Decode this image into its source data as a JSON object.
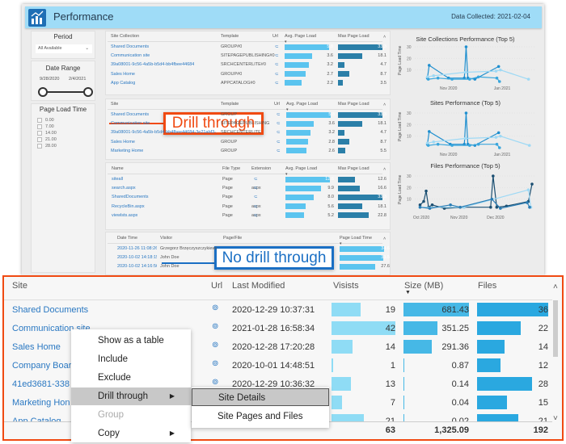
{
  "header": {
    "title": "Performance",
    "data_collected": "Data Collected: 2021-02-04",
    "logo_icon": "bar-chart-icon"
  },
  "slicers": {
    "period": {
      "label": "Period",
      "value": "All Available"
    },
    "date_range": {
      "label": "Date Range",
      "start": "9/28/2020",
      "end": "2/4/2021"
    },
    "page_load_time": {
      "label": "Page Load Time",
      "options": [
        "0.00",
        "7.00",
        "14.00",
        "21.00",
        "28.00"
      ]
    }
  },
  "site_collections_table": {
    "headers": [
      "Site Collection",
      "Template",
      "Url",
      "Avg. Page Load",
      "Max Page Load"
    ],
    "rows": [
      {
        "name": "Shared Documents",
        "template": "GROUP#0",
        "avg": "5.8",
        "max": "33.3"
      },
      {
        "name": "Communication site",
        "template": "SITEPAGEPUBLISHING#0",
        "avg": "3.6",
        "max": "18.1"
      },
      {
        "name": "39a08001-9c56-4a5b-b5d4-bb4fbee44684",
        "template": "SRCHCENTERLITE#0",
        "avg": "3.2",
        "max": "4.7"
      },
      {
        "name": "Sales Home",
        "template": "GROUP#0",
        "avg": "2.7",
        "max": "8.7"
      },
      {
        "name": "App Catalog",
        "template": "APPCATALOG#0",
        "avg": "2.2",
        "max": "3.5"
      }
    ]
  },
  "sites_table": {
    "headers": [
      "Site",
      "Template",
      "Url",
      "Avg. Page Load",
      "Max Page Load"
    ],
    "rows": [
      {
        "name": "Shared Documents",
        "template": "GROUP",
        "avg": "5.8",
        "max": "33.3"
      },
      {
        "name": "Communication site",
        "template": "SITEPAGEPUBLISHING",
        "avg": "3.6",
        "max": "18.1"
      },
      {
        "name": "39a08001-9c56-4a5b-b5d4-bb4fbee44684-3e21abf3-...",
        "template": "SRCHCENTERLITE",
        "avg": "3.2",
        "max": "4.7"
      },
      {
        "name": "Sales Home",
        "template": "GROUP",
        "avg": "2.8",
        "max": "8.7"
      },
      {
        "name": "Marketing Home",
        "template": "GROUP",
        "avg": "2.6",
        "max": "5.5"
      }
    ]
  },
  "files_table": {
    "headers": [
      "Name",
      "File Type",
      "Extension",
      "Avg. Page Load",
      "Max Page Load"
    ],
    "rows": [
      {
        "name": "siteall",
        "type": "Page",
        "ext": "",
        "avg": "12.6",
        "max": "12.6"
      },
      {
        "name": "search.aspx",
        "type": "Page",
        "ext": "aspx",
        "avg": "9.9",
        "max": "16.6"
      },
      {
        "name": "SharedDocuments",
        "type": "Page",
        "ext": "",
        "avg": "8.0",
        "max": "33.3"
      },
      {
        "name": "RecycleBin.aspx",
        "type": "Page",
        "ext": "aspx",
        "avg": "5.6",
        "max": "18.1"
      },
      {
        "name": "viewlsts.aspx",
        "type": "Page",
        "ext": "aspx",
        "avg": "5.2",
        "max": "22.8"
      }
    ]
  },
  "visits_table": {
    "headers": [
      "Date Time",
      "Visitor",
      "Page/File",
      "Page Load Time"
    ],
    "rows": [
      {
        "datetime": "2020-11-26 11:08:26",
        "visitor": "Grzegorz Brzęczyszczykiewicz",
        "load": "34.6"
      },
      {
        "datetime": "2020-10-02 14:18:15",
        "visitor": "John Doe",
        "load": "33.5"
      },
      {
        "datetime": "2020-10-02 14:16:56",
        "visitor": "John Doe",
        "load": "27.6"
      }
    ]
  },
  "annotations": {
    "drill": "Drill through",
    "no_drill": "No drill through",
    "drill_color": "#f04a12",
    "no_drill_color": "#1a6fc4"
  },
  "chart_data": [
    {
      "type": "line",
      "title": "Site Collections Performance (Top 5)",
      "ylabel": "Page Load Time",
      "xlim": [
        "2020-10-01",
        "2021-02-04"
      ],
      "ylim": [
        0,
        32
      ],
      "xticks": [
        {
          "date": "2020-11-01",
          "label": "Nov 2020"
        },
        {
          "date": "2021-01-01",
          "label": "Jan 2021"
        }
      ],
      "yticks": [
        10,
        20,
        30
      ],
      "series": [
        {
          "color": "#1f8fcf",
          "points": [
            [
              "2020-10-08",
              3
            ],
            [
              "2020-10-10",
              14
            ],
            [
              "2020-11-01",
              3
            ],
            [
              "2020-11-19",
              3
            ],
            [
              "2020-11-21",
              30
            ],
            [
              "2020-11-23",
              3
            ],
            [
              "2020-12-01",
              2
            ],
            [
              "2020-12-28",
              13
            ]
          ]
        },
        {
          "color": "#9ed9f5",
          "points": [
            [
              "2020-10-08",
              4
            ],
            [
              "2020-10-15",
              5
            ],
            [
              "2020-11-20",
              8
            ],
            [
              "2020-12-25",
              9
            ],
            [
              "2020-12-30",
              10
            ],
            [
              "2021-01-31",
              2
            ]
          ]
        },
        {
          "color": "#3aa6dc",
          "points": [
            [
              "2020-10-09",
              2
            ],
            [
              "2020-10-20",
              3
            ],
            [
              "2020-11-05",
              2
            ],
            [
              "2020-11-25",
              2
            ],
            [
              "2020-12-05",
              4
            ],
            [
              "2020-12-26",
              3
            ],
            [
              "2020-12-29",
              0
            ]
          ]
        }
      ]
    },
    {
      "type": "line",
      "title": "Sites Performance (Top 5)",
      "ylabel": "Page Load Time",
      "xlim": [
        "2020-10-01",
        "2021-02-04"
      ],
      "ylim": [
        0,
        32
      ],
      "xticks": [
        {
          "date": "2020-11-01",
          "label": "Nov 2020"
        },
        {
          "date": "2021-01-01",
          "label": "Jan 2021"
        }
      ],
      "yticks": [
        10,
        20,
        30
      ],
      "series": [
        {
          "color": "#1f8fcf",
          "points": [
            [
              "2020-10-08",
              3
            ],
            [
              "2020-10-10",
              14
            ],
            [
              "2020-11-03",
              3
            ],
            [
              "2020-11-19",
              3
            ],
            [
              "2020-11-21",
              30
            ],
            [
              "2020-11-23",
              3
            ],
            [
              "2020-12-01",
              2
            ],
            [
              "2020-12-28",
              13
            ]
          ]
        },
        {
          "color": "#9ed9f5",
          "points": [
            [
              "2020-10-08",
              4
            ],
            [
              "2020-10-15",
              5
            ],
            [
              "2020-11-20",
              8
            ],
            [
              "2020-12-25",
              9
            ],
            [
              "2020-12-30",
              10
            ],
            [
              "2021-02-01",
              2
            ]
          ]
        },
        {
          "color": "#3aa6dc",
          "points": [
            [
              "2020-10-09",
              2
            ],
            [
              "2020-10-20",
              3
            ],
            [
              "2020-11-05",
              2
            ],
            [
              "2020-11-25",
              2
            ],
            [
              "2020-12-05",
              3
            ],
            [
              "2020-12-26",
              3
            ],
            [
              "2020-12-29",
              0
            ]
          ]
        }
      ]
    },
    {
      "type": "line",
      "title": "Files Performance (Top 5)",
      "ylabel": "Page Load Time",
      "xlim": [
        "2020-10-01",
        "2020-12-31"
      ],
      "ylim": [
        0,
        32
      ],
      "xticks": [
        {
          "date": "2020-10-01",
          "label": "Oct 2020"
        },
        {
          "date": "2020-11-01",
          "label": "Nov 2020"
        },
        {
          "date": "2020-12-01",
          "label": "Dec 2020"
        }
      ],
      "yticks": [
        10,
        20,
        30
      ],
      "series": [
        {
          "color": "#1b4f72",
          "points": [
            [
              "2020-09-30",
              5
            ],
            [
              "2020-10-03",
              8
            ],
            [
              "2020-10-05",
              17
            ],
            [
              "2020-10-07",
              3
            ],
            [
              "2020-10-10",
              5
            ],
            [
              "2020-10-20",
              2
            ],
            [
              "2020-11-05",
              3
            ],
            [
              "2020-11-27",
              3
            ],
            [
              "2020-11-29",
              30
            ],
            [
              "2020-12-02",
              3
            ],
            [
              "2020-12-10",
              4
            ],
            [
              "2020-12-28",
              8
            ],
            [
              "2020-12-31",
              23
            ]
          ]
        },
        {
          "color": "#9ed9f5",
          "points": [
            [
              "2020-09-30",
              3
            ],
            [
              "2020-11-05",
              3
            ],
            [
              "2020-12-28",
              18
            ],
            [
              "2020-12-30",
              3
            ]
          ]
        },
        {
          "color": "#2a7db5",
          "points": [
            [
              "2020-09-30",
              3
            ],
            [
              "2020-10-08",
              2
            ],
            [
              "2020-10-25",
              5
            ],
            [
              "2020-11-02",
              3
            ],
            [
              "2020-11-28",
              10
            ],
            [
              "2020-12-05",
              2
            ],
            [
              "2020-12-27",
              7
            ],
            [
              "2020-12-29",
              3
            ]
          ]
        }
      ]
    }
  ],
  "detail_table": {
    "headers": {
      "site": "Site",
      "url": "Url",
      "modified": "Last Modified",
      "visits": "Visists",
      "size": "Size (MB)",
      "files": "Files"
    },
    "rows": [
      {
        "site": "Shared Documents",
        "modified": "2020-12-29 10:37:31",
        "visits": "19",
        "size": "681.43",
        "files": "36"
      },
      {
        "site": "Communication site",
        "modified": "2021-01-28 16:58:34",
        "visits": "42",
        "size": "351.25",
        "files": "22"
      },
      {
        "site": "Sales Home",
        "modified": "2020-12-28 17:20:28",
        "visits": "14",
        "size": "291.36",
        "files": "14"
      },
      {
        "site": "Company Boar",
        "modified": "2020-10-01 14:48:51",
        "visits": "1",
        "size": "0.87",
        "files": "12"
      },
      {
        "site": "41ed3681-338",
        "modified": "2020-12-29 10:36:32",
        "visits": "13",
        "size": "0.14",
        "files": "28"
      },
      {
        "site": "Marketing Hon",
        "modified": "",
        "visits": "7",
        "size": "0.04",
        "files": "15"
      },
      {
        "site": "App Catalog",
        "modified": "",
        "visits": "21",
        "size": "0.02",
        "files": "21"
      }
    ],
    "totals": {
      "visits": "63",
      "size": "1,325.09",
      "files": "192"
    },
    "bar_colors": {
      "visits": "#8fdcf5",
      "size": "#46b8e6",
      "files": "#2aa8e0"
    }
  },
  "context_menu": {
    "items": [
      "Show as a table",
      "Include",
      "Exclude",
      "Drill through",
      "Group",
      "Copy"
    ],
    "submenu": [
      "Site Details",
      "Site Pages and Files"
    ]
  }
}
